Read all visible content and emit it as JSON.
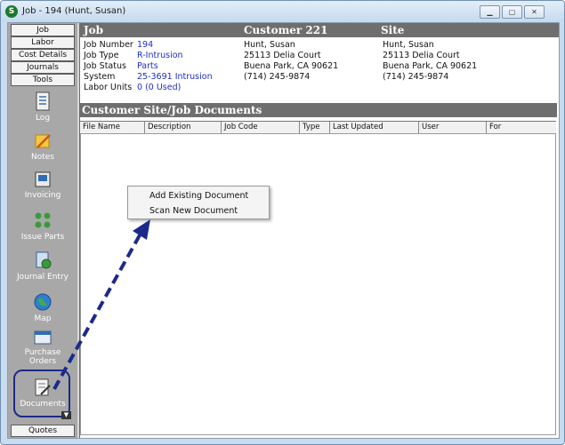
{
  "window": {
    "title": "Job - 194 (Hunt, Susan)"
  },
  "sidebar": {
    "tabs": [
      "Job",
      "Labor",
      "Cost Details",
      "Journals",
      "Tools"
    ],
    "items": [
      {
        "label": "Log",
        "icon": "log-icon"
      },
      {
        "label": "Notes",
        "icon": "notes-icon"
      },
      {
        "label": "Invoicing",
        "icon": "invoicing-icon"
      },
      {
        "label": "Issue Parts",
        "icon": "issue-parts-icon"
      },
      {
        "label": "Journal Entry",
        "icon": "journal-entry-icon"
      },
      {
        "label": "Map",
        "icon": "map-icon"
      },
      {
        "label": "Purchase Orders",
        "icon": "purchase-orders-icon"
      },
      {
        "label": "Documents",
        "icon": "documents-icon"
      }
    ],
    "bottom_tab": "Quotes"
  },
  "header": {
    "job": "Job",
    "customer": "Customer 221",
    "site": "Site"
  },
  "job_info": {
    "job_number_label": "Job Number",
    "job_number": "194",
    "job_type_label": "Job Type",
    "job_type": "R-Intrusion",
    "job_status_label": "Job Status",
    "job_status": "Parts",
    "system_label": "System",
    "system": "25-3691 Intrusion",
    "labor_units_label": "Labor Units",
    "labor_units": "0 (0 Used)"
  },
  "customer_info": {
    "name": "Hunt, Susan",
    "address": "25113 Delia Court",
    "city": "Buena Park, CA  90621",
    "phone": "(714) 245-9874"
  },
  "site_info": {
    "name": "Hunt, Susan",
    "address": "25113 Delia Court",
    "city": "Buena Park, CA  90621",
    "phone": "(714) 245-9874"
  },
  "documents": {
    "title": "Customer Site/Job Documents",
    "columns": [
      "File Name",
      "Description",
      "Job Code",
      "Type",
      "Last Updated",
      "User",
      "For"
    ]
  },
  "context_menu": {
    "items": [
      "Add Existing Document",
      "Scan New Document"
    ]
  },
  "colors": {
    "link_value": "#1f2fc7",
    "header_bg": "#6e6e6e",
    "sidebar_bg": "#a8a8a8",
    "arrow": "#1b2a8a"
  }
}
